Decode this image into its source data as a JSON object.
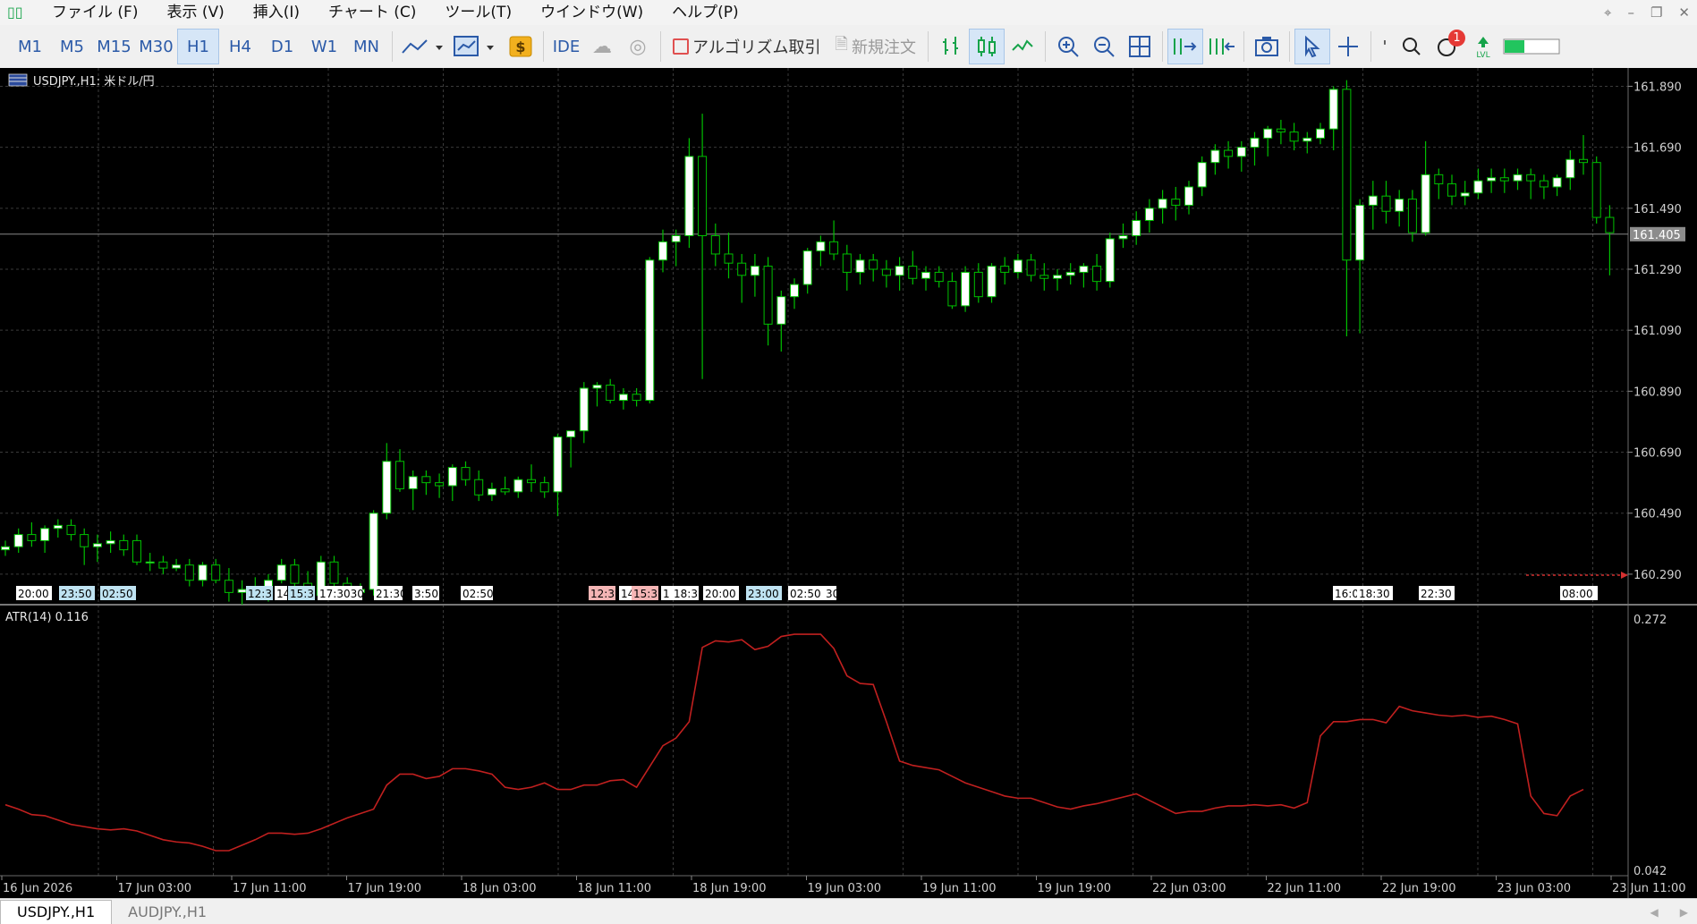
{
  "menu": {
    "items": [
      "ファイル (F)",
      "表示 (V)",
      "挿入(I)",
      "チャート (C)",
      "ツール(T)",
      "ウインドウ(W)",
      "ヘルプ(P)"
    ]
  },
  "toolbar": {
    "timeframes": [
      "M1",
      "M5",
      "M15",
      "M30",
      "H1",
      "H4",
      "D1",
      "W1",
      "MN"
    ],
    "active_timeframe": "H1",
    "ide_label": "IDE",
    "algo_label": "アルゴリズム取引",
    "new_order_label": "新規注文",
    "notification_count": "1"
  },
  "chart": {
    "symbol_label": "USDJPY.,H1:  米ドル/円",
    "indicator_label": "ATR(14) 0.116",
    "current_price_label": "161.405",
    "price_axis_labels": [
      "161.890",
      "161.690",
      "161.490",
      "161.290",
      "161.090",
      "160.890",
      "160.690",
      "160.490",
      "160.290"
    ],
    "atr_axis_labels": [
      "0.272",
      "0.042"
    ],
    "time_axis_labels": [
      "16 Jun 2026",
      "17 Jun 03:00",
      "17 Jun 11:00",
      "17 Jun 19:00",
      "18 Jun 03:00",
      "18 Jun 11:00",
      "18 Jun 19:00",
      "19 Jun 03:00",
      "19 Jun 11:00",
      "19 Jun 19:00",
      "22 Jun 03:00",
      "22 Jun 11:00",
      "22 Jun 19:00",
      "23 Jun 03:00",
      "23 Jun 11:00"
    ],
    "event_tags": [
      {
        "text": "20:00",
        "color": "#ffffff"
      },
      {
        "text": "23:50",
        "color": "#bfe3f2"
      },
      {
        "text": "02:50",
        "color": "#bfe3f2"
      },
      {
        "text": "12:3",
        "color": "#bfe3f2"
      },
      {
        "text": "14",
        "color": "#ffffff"
      },
      {
        "text": "15:3",
        "color": "#bfe3f2"
      },
      {
        "text": "17:3030",
        "color": "#ffffff"
      },
      {
        "text": "21:30",
        "color": "#ffffff"
      },
      {
        "text": "3:50",
        "color": "#ffffff"
      },
      {
        "text": "02:50",
        "color": "#ffffff"
      },
      {
        "text": "12:3",
        "color": "#f5b5b5"
      },
      {
        "text": "14",
        "color": "#ffffff"
      },
      {
        "text": "15:3",
        "color": "#f5b5b5"
      },
      {
        "text": "1",
        "color": "#ffffff"
      },
      {
        "text": "18:3",
        "color": "#ffffff"
      },
      {
        "text": "20:00",
        "color": "#ffffff"
      },
      {
        "text": "23:00",
        "color": "#bfe3f2"
      },
      {
        "text": "02:50",
        "color": "#ffffff"
      },
      {
        "text": "30",
        "color": "#ffffff"
      },
      {
        "text": "16:0",
        "color": "#ffffff"
      },
      {
        "text": "18:30",
        "color": "#ffffff"
      },
      {
        "text": "22:30",
        "color": "#ffffff"
      },
      {
        "text": "08:00",
        "color": "#ffffff"
      }
    ],
    "colors": {
      "background": "#000000",
      "grid": "#3a3a3a",
      "bull_candle": "#ffffff",
      "wick": "#00c000",
      "atr_line": "#c0201f",
      "axis_text": "#d0d0d0"
    }
  },
  "chart_data": [
    {
      "type": "candlestick",
      "title": "USDJPY.,H1:  米ドル/円",
      "ylim": [
        160.19,
        161.95
      ],
      "price_ticks": [
        161.89,
        161.69,
        161.49,
        161.29,
        161.09,
        160.89,
        160.69,
        160.49,
        160.29
      ],
      "current_price": 161.405,
      "candles": [
        [
          160.37,
          160.4,
          160.35,
          160.38
        ],
        [
          160.38,
          160.44,
          160.36,
          160.42
        ],
        [
          160.42,
          160.46,
          160.38,
          160.4
        ],
        [
          160.4,
          160.45,
          160.36,
          160.44
        ],
        [
          160.44,
          160.47,
          160.41,
          160.45
        ],
        [
          160.45,
          160.47,
          160.4,
          160.42
        ],
        [
          160.42,
          160.44,
          160.32,
          160.38
        ],
        [
          160.38,
          160.42,
          160.33,
          160.39
        ],
        [
          160.39,
          160.43,
          160.36,
          160.4
        ],
        [
          160.4,
          160.42,
          160.35,
          160.37
        ],
        [
          160.4,
          160.42,
          160.32,
          160.33
        ],
        [
          160.33,
          160.36,
          160.3,
          160.33
        ],
        [
          160.33,
          160.35,
          160.29,
          160.31
        ],
        [
          160.31,
          160.34,
          160.3,
          160.32
        ],
        [
          160.32,
          160.34,
          160.25,
          160.27
        ],
        [
          160.27,
          160.33,
          160.25,
          160.32
        ],
        [
          160.32,
          160.34,
          160.26,
          160.27
        ],
        [
          160.27,
          160.31,
          160.2,
          160.23
        ],
        [
          160.23,
          160.27,
          160.19,
          160.24
        ],
        [
          160.24,
          160.28,
          160.21,
          160.22
        ],
        [
          160.22,
          160.29,
          160.2,
          160.27
        ],
        [
          160.27,
          160.34,
          160.26,
          160.32
        ],
        [
          160.32,
          160.34,
          160.24,
          160.26
        ],
        [
          160.26,
          160.3,
          160.21,
          160.22
        ],
        [
          160.22,
          160.35,
          160.21,
          160.33
        ],
        [
          160.33,
          160.35,
          160.24,
          160.26
        ],
        [
          160.26,
          160.28,
          160.22,
          160.23
        ],
        [
          160.23,
          160.26,
          160.21,
          160.24
        ],
        [
          160.24,
          160.5,
          160.22,
          160.49
        ],
        [
          160.49,
          160.72,
          160.47,
          160.66
        ],
        [
          160.66,
          160.7,
          160.56,
          160.57
        ],
        [
          160.57,
          160.63,
          160.5,
          160.61
        ],
        [
          160.61,
          160.63,
          160.55,
          160.59
        ],
        [
          160.59,
          160.62,
          160.54,
          160.58
        ],
        [
          160.58,
          160.65,
          160.53,
          160.64
        ],
        [
          160.64,
          160.66,
          160.58,
          160.6
        ],
        [
          160.6,
          160.63,
          160.53,
          160.55
        ],
        [
          160.55,
          160.59,
          160.53,
          160.57
        ],
        [
          160.57,
          160.61,
          160.55,
          160.56
        ],
        [
          160.56,
          160.61,
          160.54,
          160.6
        ],
        [
          160.6,
          160.65,
          160.56,
          160.59
        ],
        [
          160.59,
          160.61,
          160.54,
          160.56
        ],
        [
          160.56,
          160.75,
          160.48,
          160.74
        ],
        [
          160.74,
          160.76,
          160.64,
          160.76
        ],
        [
          160.76,
          160.92,
          160.72,
          160.9
        ],
        [
          160.9,
          160.92,
          160.84,
          160.91
        ],
        [
          160.91,
          160.93,
          160.85,
          160.86
        ],
        [
          160.86,
          160.9,
          160.83,
          160.88
        ],
        [
          160.88,
          160.9,
          160.84,
          160.86
        ],
        [
          160.86,
          161.33,
          160.85,
          161.32
        ],
        [
          161.32,
          161.42,
          161.28,
          161.38
        ],
        [
          161.38,
          161.42,
          161.3,
          161.4
        ],
        [
          161.4,
          161.72,
          161.36,
          161.66
        ],
        [
          161.66,
          161.8,
          160.93,
          161.4
        ],
        [
          161.4,
          161.44,
          161.3,
          161.34
        ],
        [
          161.34,
          161.41,
          161.26,
          161.31
        ],
        [
          161.31,
          161.34,
          161.18,
          161.27
        ],
        [
          161.27,
          161.34,
          161.2,
          161.3
        ],
        [
          161.3,
          161.33,
          161.04,
          161.11
        ],
        [
          161.11,
          161.22,
          161.02,
          161.2
        ],
        [
          161.2,
          161.26,
          161.16,
          161.24
        ],
        [
          161.24,
          161.36,
          161.21,
          161.35
        ],
        [
          161.35,
          161.4,
          161.3,
          161.38
        ],
        [
          161.38,
          161.45,
          161.32,
          161.34
        ],
        [
          161.34,
          161.37,
          161.22,
          161.28
        ],
        [
          161.28,
          161.34,
          161.24,
          161.32
        ],
        [
          161.32,
          161.34,
          161.25,
          161.29
        ],
        [
          161.29,
          161.32,
          161.23,
          161.27
        ],
        [
          161.27,
          161.33,
          161.22,
          161.3
        ],
        [
          161.3,
          161.35,
          161.24,
          161.26
        ],
        [
          161.26,
          161.3,
          161.22,
          161.28
        ],
        [
          161.28,
          161.3,
          161.23,
          161.25
        ],
        [
          161.25,
          161.28,
          161.16,
          161.17
        ],
        [
          161.17,
          161.3,
          161.15,
          161.28
        ],
        [
          161.28,
          161.31,
          161.18,
          161.2
        ],
        [
          161.2,
          161.31,
          161.18,
          161.3
        ],
        [
          161.3,
          161.33,
          161.24,
          161.28
        ],
        [
          161.28,
          161.34,
          161.26,
          161.32
        ],
        [
          161.32,
          161.34,
          161.25,
          161.27
        ],
        [
          161.27,
          161.31,
          161.22,
          161.26
        ],
        [
          161.26,
          161.29,
          161.22,
          161.27
        ],
        [
          161.27,
          161.31,
          161.24,
          161.28
        ],
        [
          161.28,
          161.31,
          161.23,
          161.3
        ],
        [
          161.3,
          161.34,
          161.22,
          161.25
        ],
        [
          161.25,
          161.41,
          161.23,
          161.39
        ],
        [
          161.39,
          161.44,
          161.36,
          161.4
        ],
        [
          161.4,
          161.48,
          161.37,
          161.45
        ],
        [
          161.45,
          161.52,
          161.41,
          161.49
        ],
        [
          161.49,
          161.55,
          161.44,
          161.52
        ],
        [
          161.52,
          161.56,
          161.45,
          161.5
        ],
        [
          161.5,
          161.58,
          161.47,
          161.56
        ],
        [
          161.56,
          161.66,
          161.53,
          161.64
        ],
        [
          161.64,
          161.7,
          161.6,
          161.68
        ],
        [
          161.68,
          161.71,
          161.62,
          161.66
        ],
        [
          161.66,
          161.71,
          161.61,
          161.69
        ],
        [
          161.69,
          161.74,
          161.63,
          161.72
        ],
        [
          161.72,
          161.76,
          161.66,
          161.75
        ],
        [
          161.75,
          161.78,
          161.7,
          161.74
        ],
        [
          161.74,
          161.77,
          161.68,
          161.71
        ],
        [
          161.71,
          161.74,
          161.67,
          161.72
        ],
        [
          161.72,
          161.77,
          161.7,
          161.75
        ],
        [
          161.75,
          161.89,
          161.68,
          161.88
        ],
        [
          161.88,
          161.91,
          161.07,
          161.32
        ],
        [
          161.32,
          161.52,
          161.08,
          161.5
        ],
        [
          161.5,
          161.58,
          161.42,
          161.53
        ],
        [
          161.53,
          161.58,
          161.44,
          161.48
        ],
        [
          161.48,
          161.55,
          161.43,
          161.52
        ],
        [
          161.52,
          161.55,
          161.38,
          161.41
        ],
        [
          161.41,
          161.71,
          161.4,
          161.6
        ],
        [
          161.6,
          161.62,
          161.52,
          161.57
        ],
        [
          161.57,
          161.6,
          161.5,
          161.53
        ],
        [
          161.53,
          161.58,
          161.5,
          161.54
        ],
        [
          161.54,
          161.62,
          161.52,
          161.58
        ],
        [
          161.58,
          161.62,
          161.54,
          161.59
        ],
        [
          161.59,
          161.62,
          161.54,
          161.58
        ],
        [
          161.58,
          161.62,
          161.55,
          161.6
        ],
        [
          161.6,
          161.62,
          161.52,
          161.58
        ],
        [
          161.58,
          161.6,
          161.52,
          161.56
        ],
        [
          161.56,
          161.6,
          161.53,
          161.59
        ],
        [
          161.59,
          161.68,
          161.55,
          161.65
        ],
        [
          161.65,
          161.73,
          161.6,
          161.64
        ],
        [
          161.64,
          161.66,
          161.44,
          161.46
        ],
        [
          161.46,
          161.5,
          161.27,
          161.41
        ]
      ]
    },
    {
      "type": "line",
      "title": "ATR(14) 0.116",
      "ylim": [
        0.042,
        0.272
      ],
      "series": [
        {
          "values": [
            0.102,
            0.098,
            0.093,
            0.092,
            0.088,
            0.084,
            0.082,
            0.08,
            0.079,
            0.08,
            0.078,
            0.074,
            0.07,
            0.068,
            0.067,
            0.064,
            0.06,
            0.06,
            0.065,
            0.07,
            0.076,
            0.076,
            0.075,
            0.076,
            0.08,
            0.085,
            0.09,
            0.094,
            0.098,
            0.12,
            0.13,
            0.13,
            0.126,
            0.128,
            0.135,
            0.135,
            0.133,
            0.13,
            0.118,
            0.116,
            0.118,
            0.122,
            0.116,
            0.116,
            0.12,
            0.12,
            0.124,
            0.125,
            0.118,
            0.137,
            0.156,
            0.163,
            0.178,
            0.246,
            0.252,
            0.251,
            0.253,
            0.244,
            0.247,
            0.256,
            0.258,
            0.258,
            0.258,
            0.245,
            0.22,
            0.213,
            0.212,
            0.178,
            0.142,
            0.138,
            0.136,
            0.134,
            0.128,
            0.122,
            0.118,
            0.114,
            0.11,
            0.108,
            0.108,
            0.104,
            0.1,
            0.098,
            0.101,
            0.103,
            0.106,
            0.109,
            0.112,
            0.106,
            0.1,
            0.094,
            0.096,
            0.096,
            0.099,
            0.101,
            0.101,
            0.102,
            0.101,
            0.102,
            0.099,
            0.104,
            0.165,
            0.178,
            0.178,
            0.18,
            0.18,
            0.177,
            0.192,
            0.188,
            0.186,
            0.184,
            0.183,
            0.184,
            0.182,
            0.183,
            0.18,
            0.176,
            0.11,
            0.094,
            0.092,
            0.11,
            0.116
          ]
        }
      ]
    }
  ]
}
